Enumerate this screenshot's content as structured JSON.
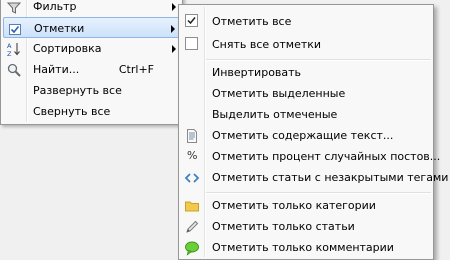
{
  "parent_menu": {
    "items": [
      {
        "label": "Фильтр",
        "icon": "filter-icon",
        "submenu": true
      },
      {
        "label": "Отметки",
        "icon": "checkmarks-icon",
        "submenu": true,
        "highlighted": true
      },
      {
        "label": "Сортировка",
        "icon": "sort-az-icon",
        "submenu": true
      },
      {
        "label": "Найти...",
        "icon": "magnifier-icon",
        "shortcut": "Ctrl+F"
      },
      {
        "label": "Развернуть все"
      },
      {
        "label": "Свернуть все"
      }
    ]
  },
  "marks_submenu": {
    "items": [
      {
        "label": "Отметить все",
        "icon": "checked-checkbox-icon"
      },
      {
        "label": "Снять все отметки",
        "icon": "unchecked-checkbox-icon"
      },
      {
        "label": "Инвертировать"
      },
      {
        "label": "Отметить выделенные"
      },
      {
        "label": "Выделить отмеченые"
      },
      {
        "label": "Отметить содержащие текст...",
        "icon": "text-document-icon"
      },
      {
        "label": "Отметить процент случайных постов...",
        "icon": "percent-icon",
        "icon_text": "%"
      },
      {
        "label": "Отметить статьи с незакрытыми тегами",
        "icon": "code-tags-icon"
      },
      {
        "label": "Отметить только категории",
        "icon": "folder-icon"
      },
      {
        "label": "Отметить только статьи",
        "icon": "pencil-icon"
      },
      {
        "label": "Отметить только комментарии",
        "icon": "speech-bubble-icon"
      }
    ]
  },
  "colors": {
    "menu_background": "#f8f8f8",
    "menu_border": "#979797",
    "highlight_border": "#8fb6e6",
    "folder": "#f2c94c",
    "comment_bubble": "#6ccf3a",
    "code_tags": "#3b82c4"
  }
}
